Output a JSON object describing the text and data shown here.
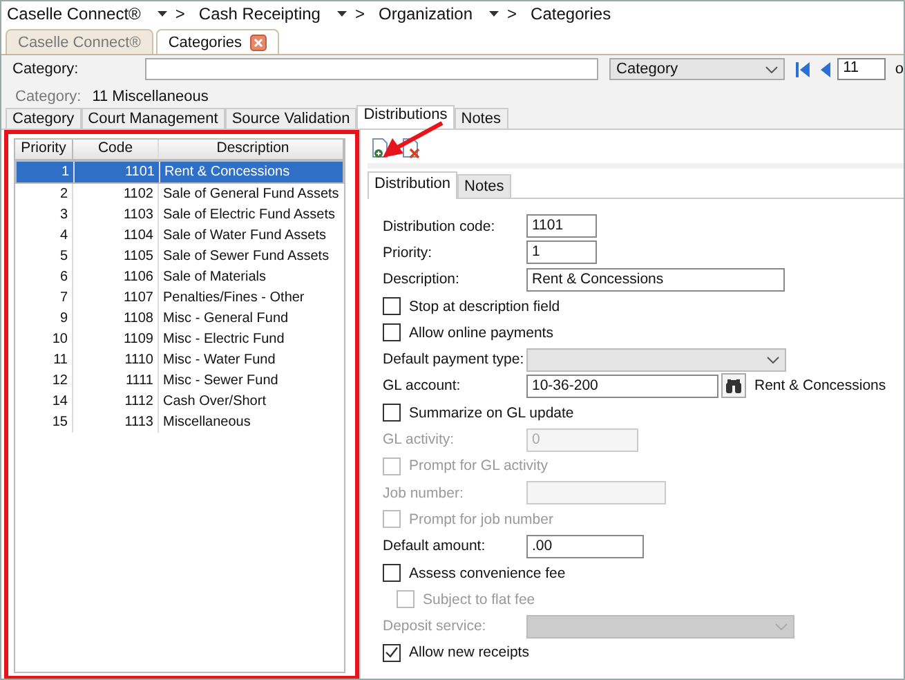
{
  "breadcrumb": [
    {
      "label": "Caselle Connect®",
      "separator": ">"
    },
    {
      "label": "Cash Receipting",
      "separator": ">"
    },
    {
      "label": "Organization",
      "separator": ">"
    },
    {
      "label": "Categories"
    }
  ],
  "doc_tabs": [
    {
      "label": "Caselle Connect®",
      "selected": false,
      "closable": false
    },
    {
      "label": "Categories",
      "selected": true,
      "closable": true
    }
  ],
  "search": {
    "label": "Category:",
    "filter": "Category",
    "record": "11",
    "record_of": "o"
  },
  "current": {
    "label": "Category:",
    "value": "11  Miscellaneous"
  },
  "tabs": [
    {
      "label": "Category",
      "selected": false
    },
    {
      "label": "Court Management",
      "selected": false
    },
    {
      "label": "Source Validation",
      "selected": false
    },
    {
      "label": "Distributions",
      "selected": true
    },
    {
      "label": "Notes",
      "selected": false
    }
  ],
  "grid": {
    "columns": [
      "Priority",
      "Code",
      "Description"
    ],
    "rows": [
      {
        "priority": "1",
        "code": "1101",
        "description": "Rent & Concessions",
        "selected": true
      },
      {
        "priority": "2",
        "code": "1102",
        "description": "Sale of General Fund Assets",
        "selected": false
      },
      {
        "priority": "3",
        "code": "1103",
        "description": "Sale of Electric Fund Assets",
        "selected": false
      },
      {
        "priority": "4",
        "code": "1104",
        "description": "Sale of Water Fund Assets",
        "selected": false
      },
      {
        "priority": "5",
        "code": "1105",
        "description": "Sale of Sewer Fund Assets",
        "selected": false
      },
      {
        "priority": "6",
        "code": "1106",
        "description": "Sale of Materials",
        "selected": false
      },
      {
        "priority": "7",
        "code": "1107",
        "description": "Penalties/Fines - Other",
        "selected": false
      },
      {
        "priority": "9",
        "code": "1108",
        "description": "Misc - General Fund",
        "selected": false
      },
      {
        "priority": "10",
        "code": "1109",
        "description": "Misc - Electric Fund",
        "selected": false
      },
      {
        "priority": "11",
        "code": "1110",
        "description": "Misc - Water Fund",
        "selected": false
      },
      {
        "priority": "12",
        "code": "1111",
        "description": "Misc - Sewer Fund",
        "selected": false
      },
      {
        "priority": "14",
        "code": "1112",
        "description": "Cash Over/Short",
        "selected": false
      },
      {
        "priority": "15",
        "code": "1113",
        "description": "Miscellaneous",
        "selected": false
      }
    ]
  },
  "sub_tabs": [
    {
      "label": "Distribution",
      "selected": true
    },
    {
      "label": "Notes",
      "selected": false
    }
  ],
  "form": [
    {
      "kind": "field",
      "label": "Distribution code:",
      "value": "1101",
      "disabled": false
    },
    {
      "kind": "field",
      "label": "Priority:",
      "value": "1",
      "disabled": false
    },
    {
      "kind": "field",
      "label": "Description:",
      "value": "Rent & Concessions",
      "disabled": false
    },
    {
      "kind": "checkbox",
      "label": "Stop at description field",
      "checked": false,
      "disabled": false
    },
    {
      "kind": "checkbox",
      "label": "Allow online payments",
      "checked": false,
      "disabled": false
    },
    {
      "kind": "select",
      "label": "Default payment type:",
      "disabled": false
    },
    {
      "kind": "lookup",
      "label": "GL account:",
      "value": "10-36-200",
      "note": "Rent & Concessions",
      "disabled": false
    },
    {
      "kind": "checkbox",
      "label": "Summarize on GL update",
      "checked": false,
      "disabled": false
    },
    {
      "kind": "field",
      "label": "GL activity:",
      "value": "0",
      "disabled": true
    },
    {
      "kind": "checkbox",
      "label": "Prompt for GL activity",
      "checked": false,
      "disabled": true
    },
    {
      "kind": "field",
      "label": "Job number:",
      "disabled": true
    },
    {
      "kind": "checkbox",
      "label": "Prompt for job number",
      "checked": false,
      "disabled": true
    },
    {
      "kind": "field",
      "label": "Default amount:",
      "value": ".00",
      "disabled": false
    },
    {
      "kind": "checkbox",
      "label": "Assess convenience fee",
      "checked": false,
      "disabled": false,
      "children": [
        {
          "kind": "checkbox",
          "label": "Subject to flat fee",
          "checked": false,
          "disabled": true
        }
      ]
    },
    {
      "kind": "select",
      "label": "Deposit service:",
      "disabled": true
    },
    {
      "kind": "checkbox",
      "label": "Allow new receipts",
      "checked": true,
      "disabled": false
    }
  ]
}
